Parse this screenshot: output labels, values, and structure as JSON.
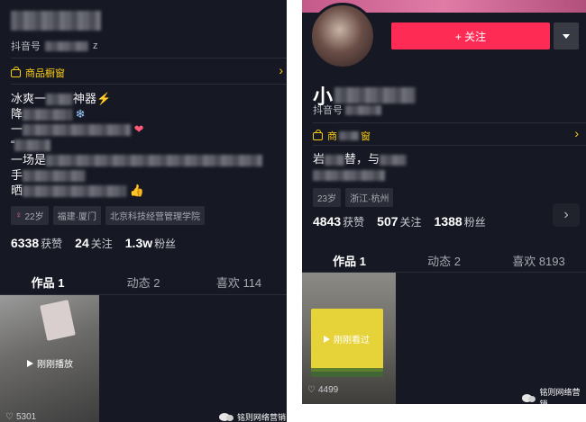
{
  "left": {
    "tiktok_id_label": "抖音号",
    "tiktok_id_value_tail": "z",
    "shop_label": "商品橱窗",
    "shop_arrow": "›",
    "bio_lines": [
      "冰爽一",
      "神器⚡",
      "降",
      "一",
      "“",
      "一场是",
      "手",
      "晒",
      "晒"
    ],
    "tags": [
      "22岁",
      "福建·厦门",
      "北京科技经营管理学院"
    ],
    "stats": [
      {
        "value": "6338",
        "label": "获赞"
      },
      {
        "value": "24",
        "label": "关注"
      },
      {
        "value": "1.3w",
        "label": "粉丝"
      }
    ],
    "tabs": [
      "作品 1",
      "动态 2",
      "喜欢 114"
    ],
    "thumb_label": "刚刚播放",
    "thumb_likes": "5301",
    "watermark": "铭则网络营销"
  },
  "right": {
    "follow_label": "+ 关注",
    "name_prefix": "小",
    "tiktok_id_label": "抖音号",
    "shop_label": "商",
    "shop_label_tail": "窗",
    "shop_arrow": "›",
    "bio_prefix": "岩",
    "bio_mid": "替，与",
    "tags": [
      "23岁",
      "浙江·杭州"
    ],
    "stats": [
      {
        "value": "4843",
        "label": "获赞"
      },
      {
        "value": "507",
        "label": "关注"
      },
      {
        "value": "1388",
        "label": "粉丝"
      }
    ],
    "tabs": [
      "作品 1",
      "动态 2",
      "喜欢 8193"
    ],
    "thumb_label": "刚刚看过",
    "thumb_likes": "4499",
    "watermark": "铭则网络营销"
  },
  "colors": {
    "bg": "#161823",
    "accent_yellow": "#face15",
    "follow_red": "#fe2c55"
  }
}
